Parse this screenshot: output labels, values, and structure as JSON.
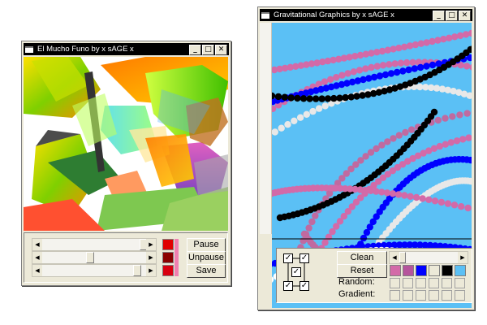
{
  "left_window": {
    "title": "El Mucho Funo by x sAGE x",
    "controls": {
      "minimize": "_",
      "maximize": "□",
      "close": "✕"
    },
    "buttons": {
      "pause": "Pause",
      "unpause": "Unpause",
      "save": "Save"
    },
    "swatches": [
      "#e00000",
      "#8b0000",
      "#d80010"
    ],
    "sliders": [
      0.94,
      0.5,
      0.88
    ]
  },
  "right_window": {
    "title": "Gravitational Graphics by x sAGE x",
    "controls": {
      "minimize": "_",
      "maximize": "□",
      "close": "✕"
    },
    "buttons": {
      "clean": "Clean",
      "reset": "Reset"
    },
    "labels": {
      "random": "Random:",
      "gradient": "Gradient:"
    },
    "checkbox_mark": "✓",
    "color_swatches": [
      "#d36aa8",
      "#b5549c",
      "#0000ff",
      "#ece9d8",
      "#000000",
      "#5bc0f5"
    ],
    "slider": 0.0
  },
  "icons": {
    "app": "app-window-icon",
    "scroll_left": "arrow-left-icon",
    "scroll_right": "arrow-right-icon"
  }
}
